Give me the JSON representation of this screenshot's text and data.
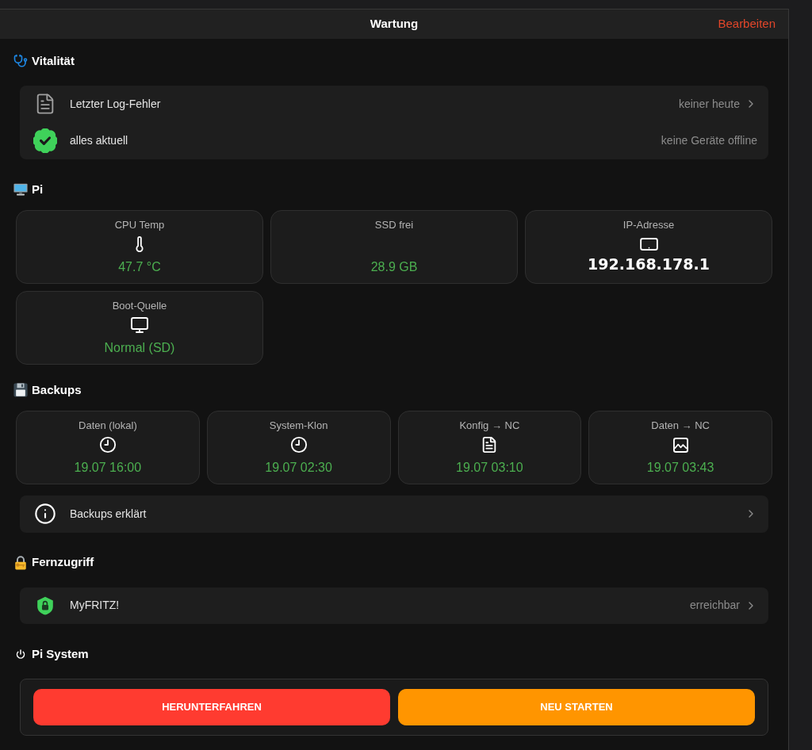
{
  "header": {
    "title": "Wartung",
    "action": "Bearbeiten"
  },
  "sections": [
    {
      "title": "Vitalität",
      "rows": [
        {
          "label": "Letzter Log-Fehler",
          "value": "keiner heute",
          "chevron": true
        },
        {
          "label": "alles aktuell",
          "value": "keine Geräte offline",
          "chevron": false
        }
      ]
    },
    {
      "title": "Pi",
      "tiles": [
        {
          "label": "CPU Temp",
          "value": "47.7 °C",
          "kind": "status"
        },
        {
          "label": "SSD frei",
          "value": "28.9 GB",
          "kind": "status"
        },
        {
          "label": "IP-Adresse",
          "value": "192.168.178.1",
          "kind": "address"
        },
        {
          "label": "Boot-Quelle",
          "value": "Normal (SD)",
          "kind": "status"
        }
      ]
    },
    {
      "title": "Backups",
      "tiles": [
        {
          "label": "Daten (lokal)",
          "value": "19.07 16:00",
          "kind": "status"
        },
        {
          "label": "System-Klon",
          "value": "19.07 02:30",
          "kind": "status"
        },
        {
          "label": "Konfig → NC",
          "value": "19.07 03:10",
          "kind": "status"
        },
        {
          "label": "Daten → NC",
          "value": "19.07 03:43",
          "kind": "status"
        }
      ],
      "rows": [
        {
          "label": "Backups erklärt",
          "chevron": true
        }
      ]
    },
    {
      "title": "Fernzugriff",
      "rows": [
        {
          "label": "MyFRITZ!",
          "value": "erreichbar",
          "chevron": true
        }
      ]
    },
    {
      "title": "Pi System",
      "buttons": [
        {
          "label": "HERUNTERFAHREN",
          "kind": "danger"
        },
        {
          "label": "NEU STARTEN",
          "kind": "warning"
        }
      ]
    }
  ]
}
